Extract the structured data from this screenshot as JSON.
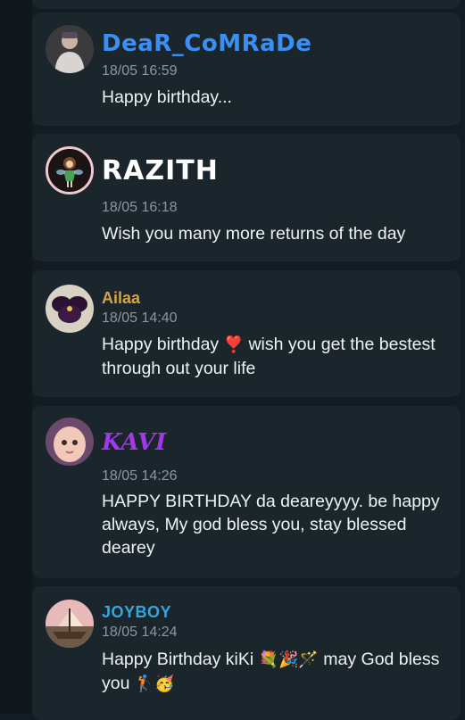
{
  "comments": [
    {
      "username": "DeaR_CoMRaDe",
      "timestamp": "18/05 16:59",
      "message": "Happy birthday...",
      "name_color": "#3a8ff5"
    },
    {
      "username": "RAZITH",
      "timestamp": "18/05 16:18",
      "message": "Wish you many more returns of the day",
      "name_color": "#ffffff"
    },
    {
      "username": "Ailaa",
      "timestamp": "18/05 14:40",
      "message_before_emoji": "Happy birthday",
      "heart_emoji": "❣️",
      "message_after_emoji": "wish you get the bestest through out your life",
      "name_color": "#d7a443"
    },
    {
      "username": "KAVI",
      "timestamp": "18/05 14:26",
      "message": "HAPPY BIRTHDAY da deareyyyy. be happy always, My god bless you, stay blessed dearey",
      "name_color": "#a238e8"
    },
    {
      "username": "JOYBOY",
      "timestamp": "18/05 14:24",
      "message_part1": "Happy Birthday kiKi",
      "emojis_1": "💐🎉🪄",
      "message_part2": "may God bless you",
      "emojis_2": "🏌️🥳",
      "name_color": "#33a8e0"
    }
  ]
}
